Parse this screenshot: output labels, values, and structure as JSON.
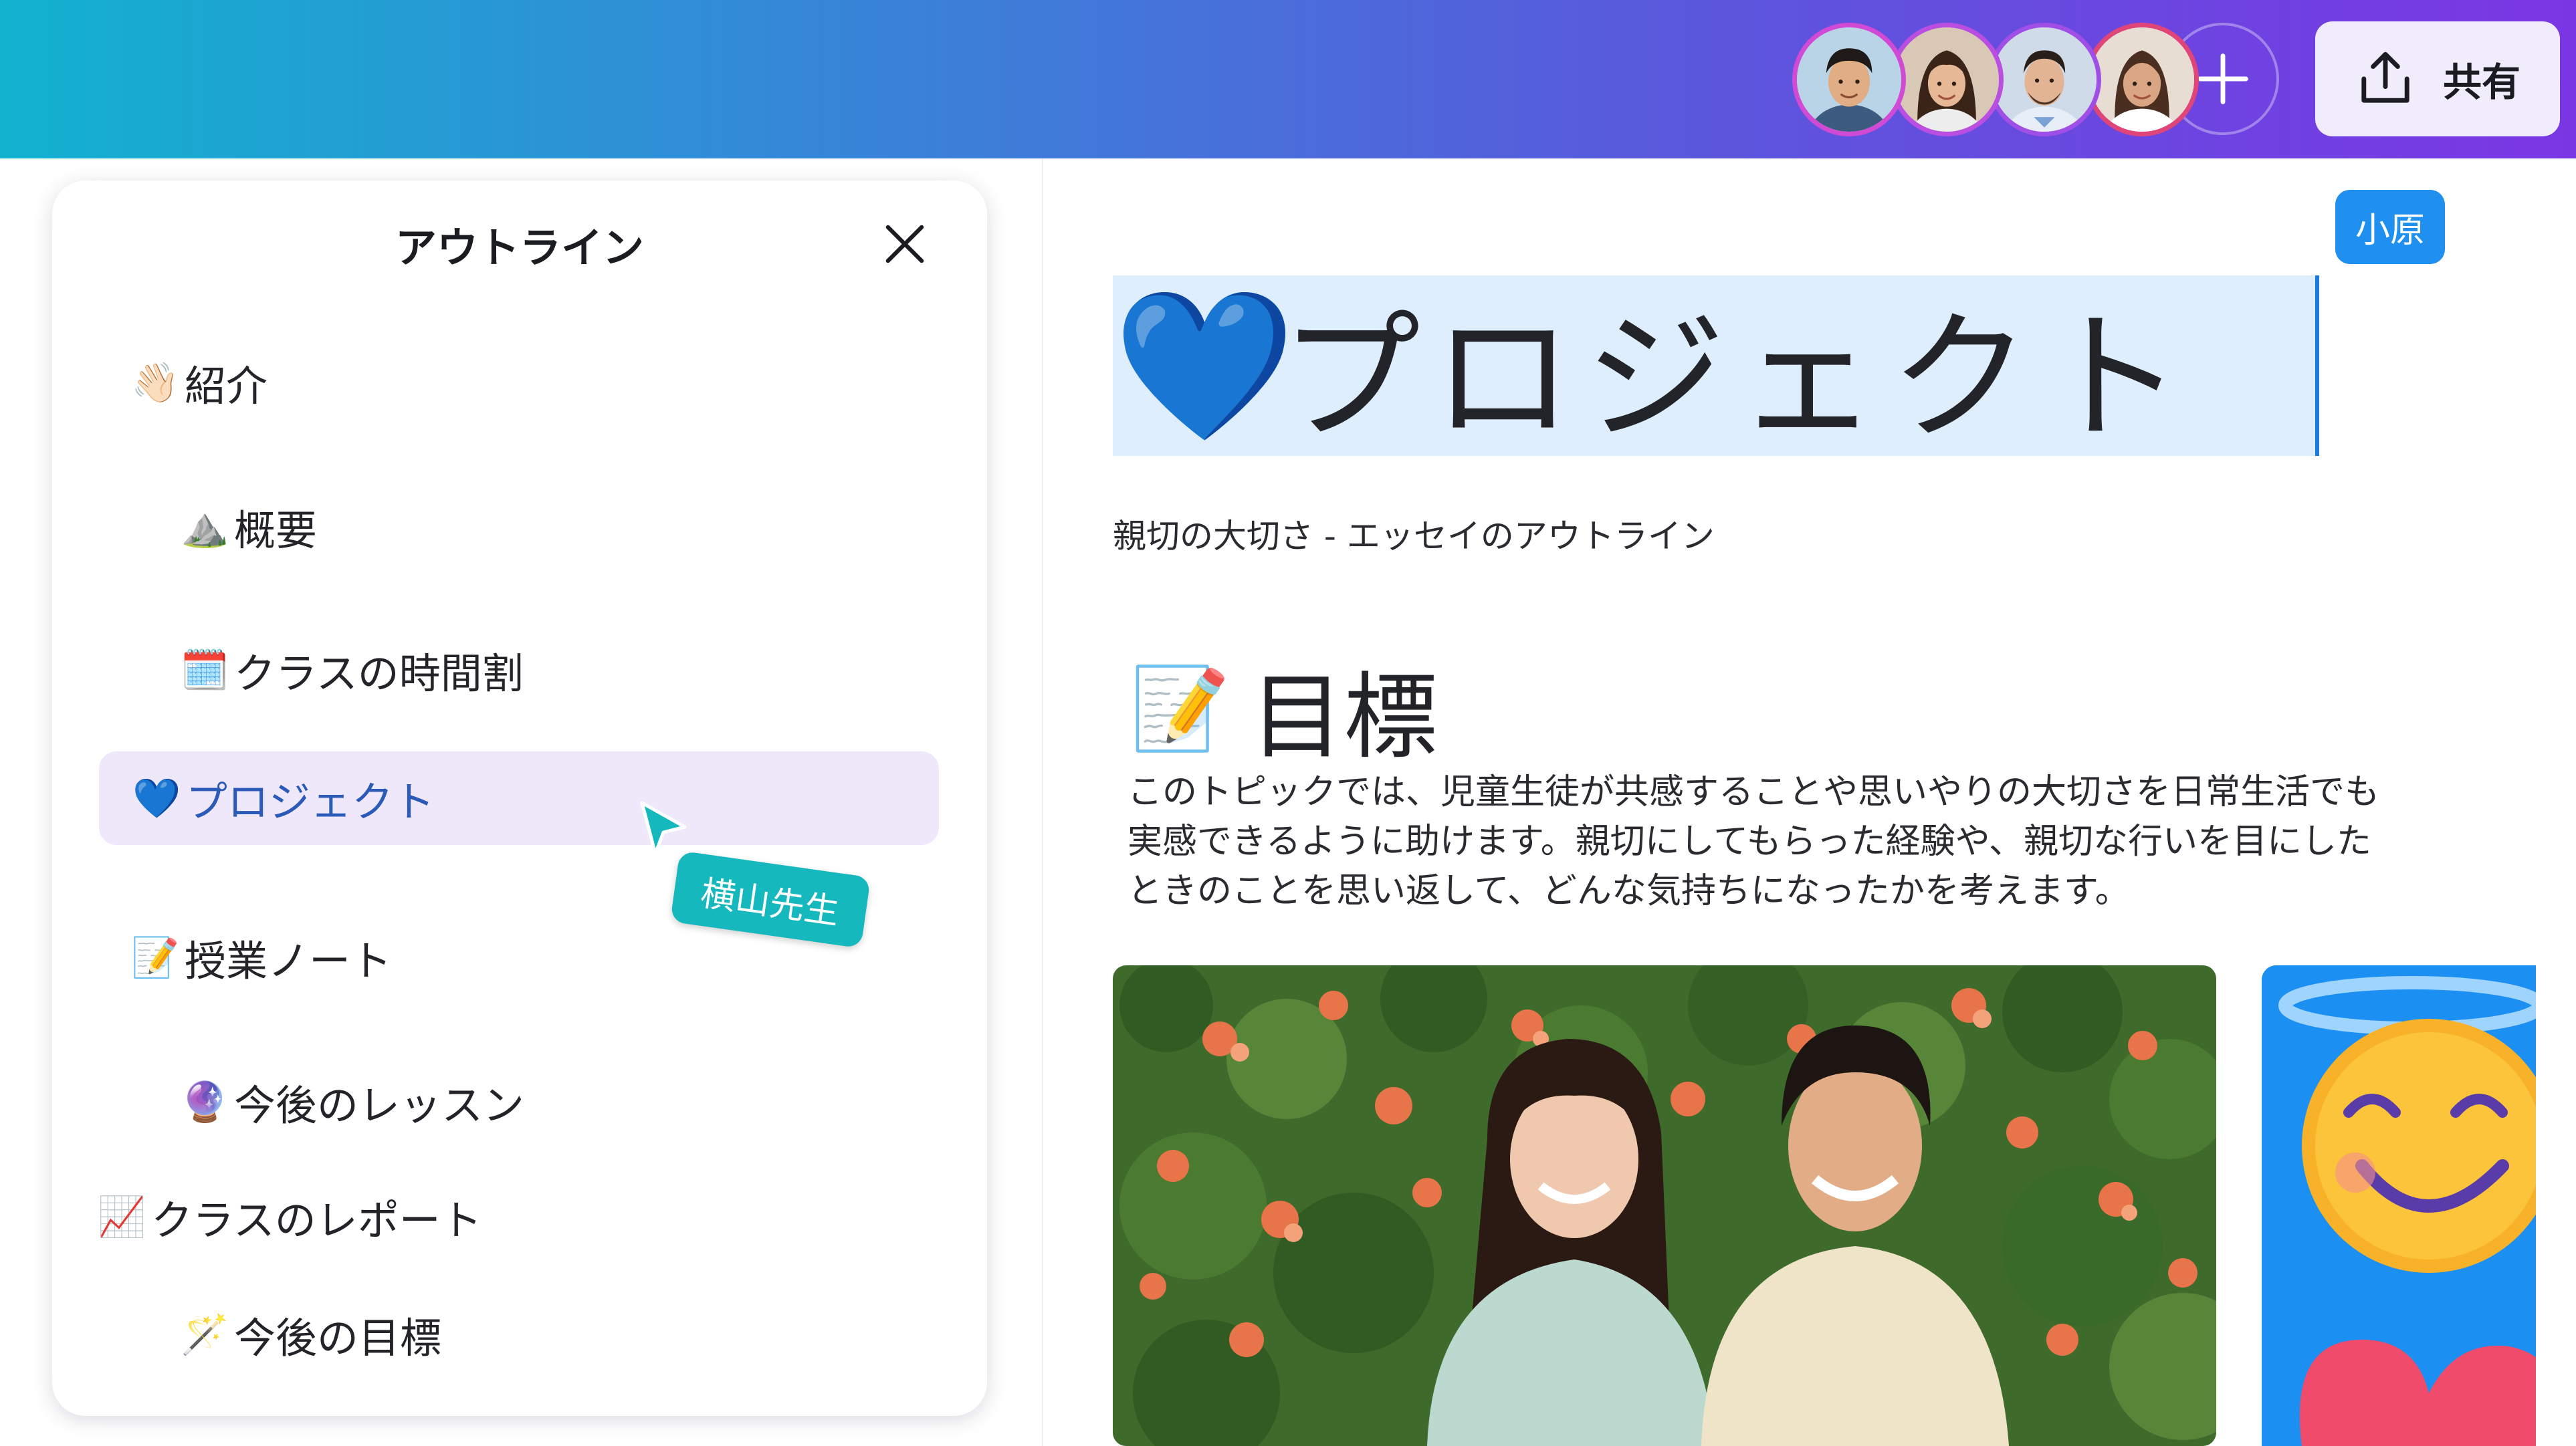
{
  "topbar": {
    "collaborators": [
      {
        "name": "avatar-boy"
      },
      {
        "name": "avatar-girl"
      },
      {
        "name": "avatar-man"
      },
      {
        "name": "avatar-woman"
      }
    ],
    "add_icon": "plus-icon",
    "share": {
      "label": "共有",
      "icon": "upload-icon"
    }
  },
  "outline": {
    "title": "アウトライン",
    "close_icon": "close-icon",
    "items": [
      {
        "emoji": "👋🏻",
        "label": "紹介",
        "level": 0,
        "active": false
      },
      {
        "emoji": "⛰️",
        "label": "概要",
        "level": 1,
        "active": false
      },
      {
        "emoji": "🗓️",
        "label": "クラスの時間割",
        "level": 1,
        "active": false
      },
      {
        "emoji": "💙",
        "label": "プロジェクト",
        "level": 0,
        "active": true
      },
      {
        "emoji": "📝",
        "label": "授業ノート",
        "level": 0,
        "active": false
      },
      {
        "emoji": "🔮",
        "label": "今後のレッスン",
        "level": 1,
        "active": false
      },
      {
        "emoji": "📈",
        "label": "クラスのレポート",
        "level": -1,
        "active": false
      },
      {
        "emoji": "🪄",
        "label": "今後の目標",
        "level": 1,
        "active": false
      }
    ]
  },
  "cursor_tag": {
    "label": "横山先生",
    "color": "#15b8bd"
  },
  "document": {
    "editor_tag": {
      "label": "小原",
      "color": "#1f8ff0"
    },
    "title_emoji": "💙",
    "title": "プロジェクト",
    "subtitle": "親切の大切さ - エッセイのアウトライン",
    "section": {
      "emoji": "📝",
      "heading": "目標",
      "paragraph_lines": [
        "このトピックでは、児童生徒が共感することや思いやりの大切さを日常生活でも",
        "実感できるように助けます。親切にしてもらった経験や、親切な行いを目にした",
        "ときのことを思い返して、どんな気持ちになったかを考えます。"
      ]
    }
  },
  "colors": {
    "gradient_start": "#12b2cf",
    "gradient_end": "#7b36e4",
    "active_item_bg": "#efe8fb",
    "title_highlight": "#dfeefd"
  }
}
